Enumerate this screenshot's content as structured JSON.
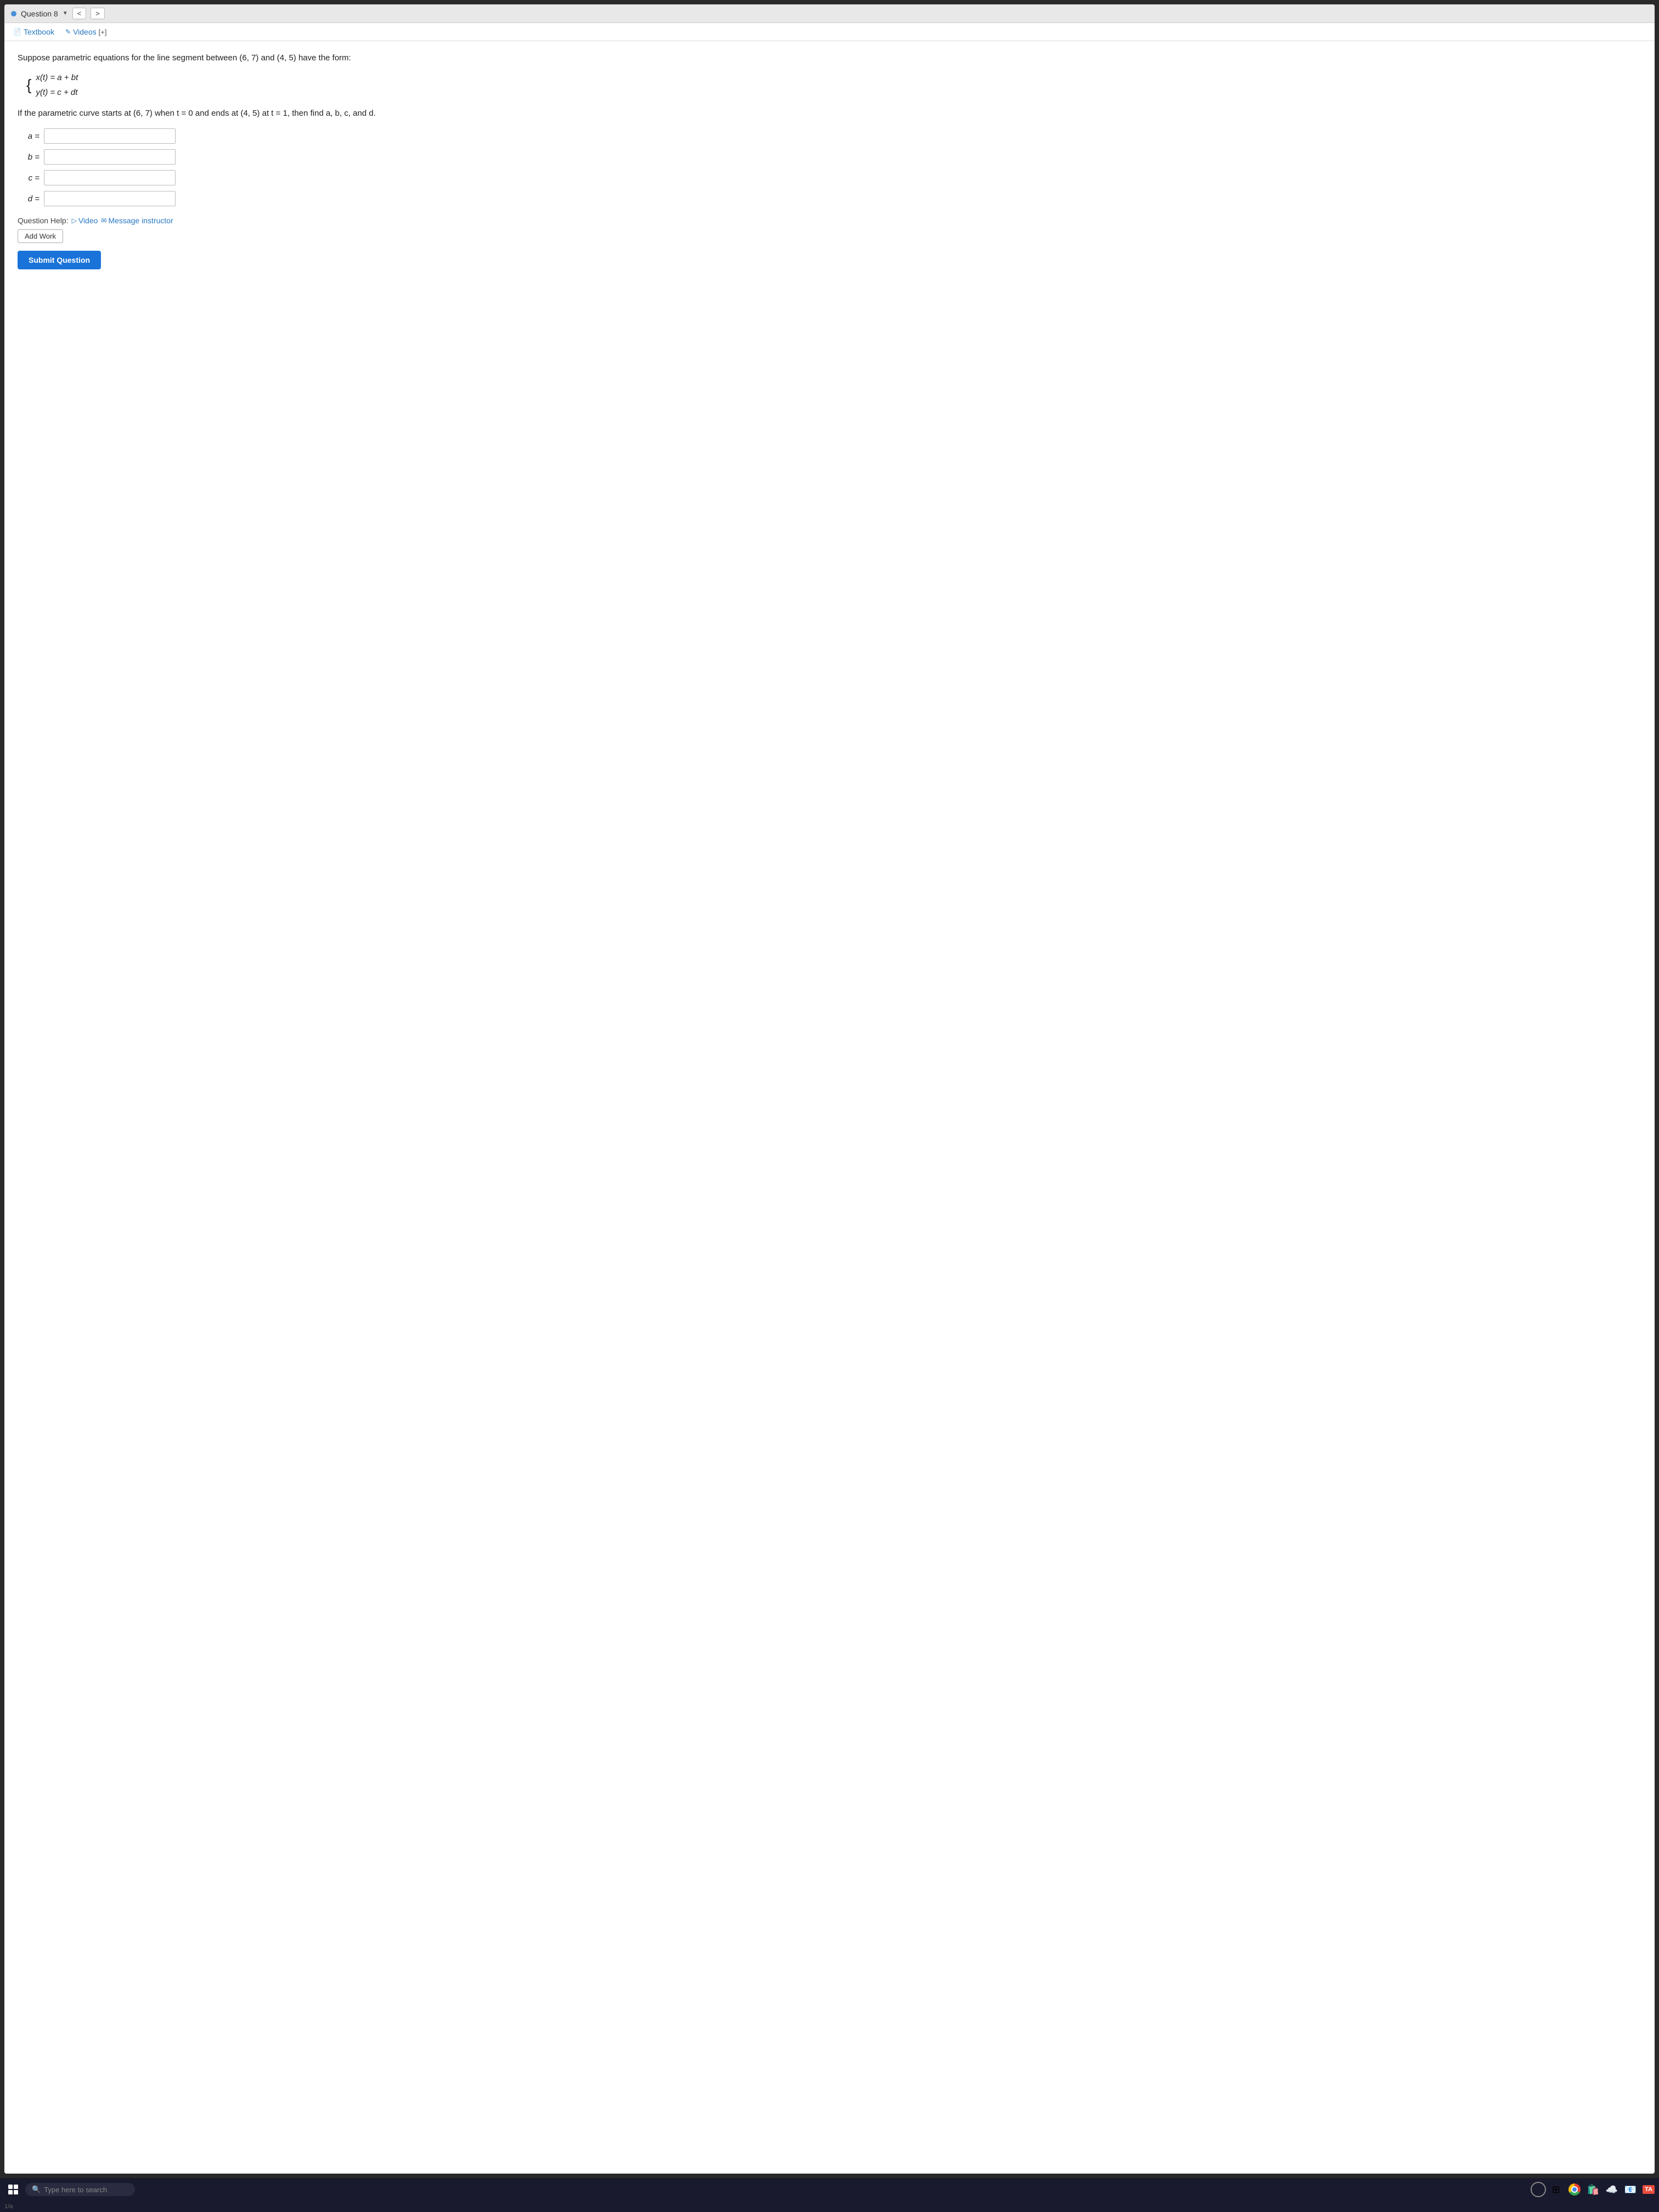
{
  "nav": {
    "question_label": "Question 8",
    "prev_arrow": "<",
    "next_arrow": ">"
  },
  "tabs": {
    "textbook_label": "Textbook",
    "videos_label": "Videos",
    "add_label": "[+]",
    "textbook_icon": "📄",
    "videos_icon": "✎"
  },
  "question": {
    "intro": "Suppose parametric equations for the line segment between (6, 7) and (4, 5) have the form:",
    "eq1": "x(t) = a + bt",
    "eq2": "y(t) = c + dt",
    "followup": "If the parametric curve starts at (6, 7) when t = 0 and ends at (4, 5) at t = 1, then find a, b, c, and d.",
    "a_label": "a =",
    "b_label": "b =",
    "c_label": "c =",
    "d_label": "d =",
    "a_value": "",
    "b_value": "",
    "c_value": "",
    "d_value": "",
    "help_label": "Question Help:",
    "video_link": "Video",
    "message_link": "Message instructor",
    "add_work_label": "Add Work",
    "submit_label": "Submit Question"
  },
  "taskbar": {
    "search_placeholder": "Type here to search"
  }
}
